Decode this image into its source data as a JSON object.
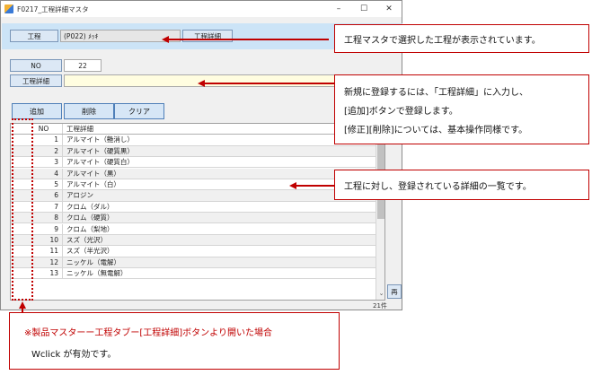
{
  "window": {
    "title": "F0217_工程詳細マスタ",
    "minimize": "–",
    "maximize": "☐",
    "close": "✕"
  },
  "header": {
    "process_label": "工程",
    "process_value": "(P022) ﾒｯｷ",
    "detail_button": "工程詳細"
  },
  "form": {
    "no_label": "NO",
    "no_value": "22",
    "detail_label": "工程詳細",
    "detail_value": ""
  },
  "toolbar": {
    "add": "追加",
    "delete": "削除",
    "clear": "クリア"
  },
  "grid": {
    "columns": [
      "NO",
      "工程詳細"
    ],
    "rows": [
      {
        "no": "1",
        "name": "アルマイト（艶消し）"
      },
      {
        "no": "2",
        "name": "アルマイト（硬質黒）"
      },
      {
        "no": "3",
        "name": "アルマイト（硬質白）"
      },
      {
        "no": "4",
        "name": "アルマイト（黒）"
      },
      {
        "no": "5",
        "name": "アルマイト（白）"
      },
      {
        "no": "6",
        "name": "アロジン"
      },
      {
        "no": "7",
        "name": "クロム（ダル）"
      },
      {
        "no": "8",
        "name": "クロム（硬質）"
      },
      {
        "no": "9",
        "name": "クロム（梨地）"
      },
      {
        "no": "10",
        "name": "スズ（光沢）"
      },
      {
        "no": "11",
        "name": "スズ（半光沢）"
      },
      {
        "no": "12",
        "name": "ニッケル（電解）"
      },
      {
        "no": "13",
        "name": "ニッケル（無電解）"
      }
    ],
    "side_button": "再",
    "count": "21件"
  },
  "callouts": {
    "c1": "工程マスタで選択した工程が表示されています。",
    "c2_line1": "新規に登録するには、「工程詳細」に入力し、",
    "c2_line2": "[追加]ボタンで登録します。",
    "c2_line3": "[修正][削除]については、基本操作同様です。",
    "c3": "工程に対し、登録されている詳細の一覧です。",
    "note_line1": "※製品マスターー工程タブー[工程詳細]ボタンより開いた場合",
    "note_line2": "Wclick が有効です。"
  },
  "colors": {
    "accent_red": "#c00000",
    "header_band": "#cce4f7",
    "input_highlight": "#fffde0"
  }
}
